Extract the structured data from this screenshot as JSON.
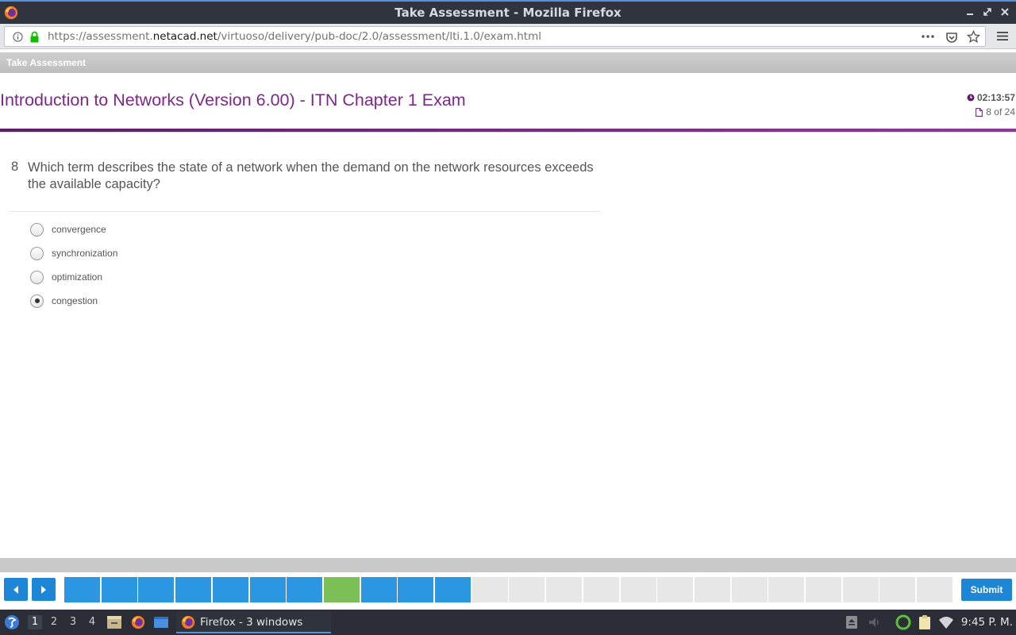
{
  "window": {
    "title": "Take Assessment - Mozilla Firefox"
  },
  "browser": {
    "url_prefix": "https://assessment.",
    "url_host": "netacad.net",
    "url_path": "/virtuoso/delivery/pub-doc/2.0/assessment/lti.1.0/exam.html"
  },
  "app": {
    "strip_label": "Take Assessment",
    "exam_title": "Introduction to Networks (Version 6.00) - ITN Chapter 1 Exam",
    "timer": "02:13:57",
    "progress_text": "8 of 24",
    "accent_color": "#7a2a86"
  },
  "question": {
    "number": "8",
    "text": "Which term describes the state of a network when the demand on the network resources exceeds the available capacity?",
    "options": [
      {
        "label": "convergence",
        "selected": false
      },
      {
        "label": "synchronization",
        "selected": false
      },
      {
        "label": "optimization",
        "selected": false
      },
      {
        "label": "congestion",
        "selected": true
      }
    ]
  },
  "navigation": {
    "submit_label": "Submit",
    "total_questions": 24,
    "current_question": 8,
    "answered_questions": [
      1,
      2,
      3,
      4,
      5,
      6,
      7,
      8,
      9,
      10,
      11
    ],
    "colors": {
      "answered": "#2b97e3",
      "current": "#7cbf56",
      "unanswered": "#e7e7e7"
    }
  },
  "taskbar": {
    "workspaces": [
      "1",
      "2",
      "3",
      "4"
    ],
    "active_workspace": "1",
    "task_label": "Firefox - 3 windows",
    "clock": "9:45 P. M."
  }
}
